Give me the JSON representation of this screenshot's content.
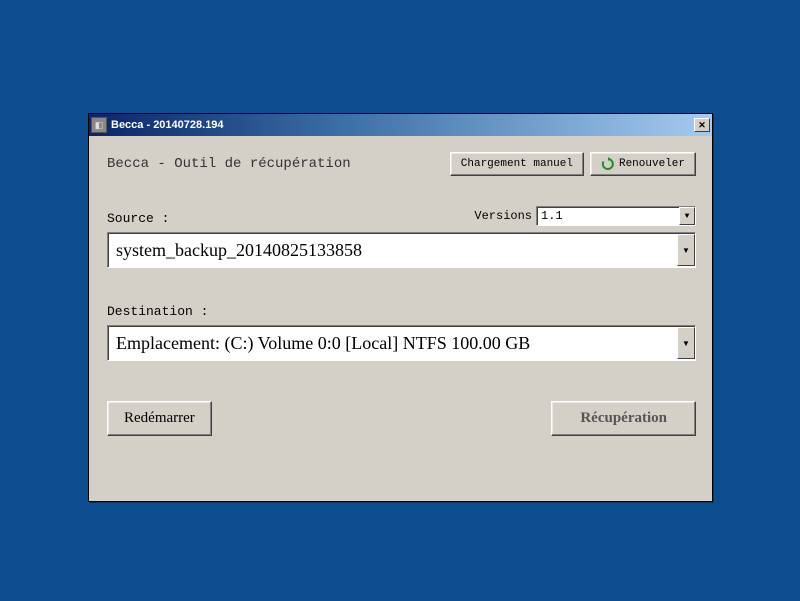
{
  "window": {
    "title": "Becca - 20140728.194"
  },
  "header": {
    "app_title": "Becca - Outil de récupération",
    "manual_load_label": "Chargement manuel",
    "refresh_label": "Renouveler"
  },
  "source": {
    "label": "Source :",
    "value": "system_backup_20140825133858"
  },
  "versions": {
    "label": "Versions",
    "value": "1.1"
  },
  "destination": {
    "label": "Destination :",
    "value": "Emplacement: (C:) Volume 0:0 [Local] NTFS 100.00 GB"
  },
  "footer": {
    "restart_label": "Redémarrer",
    "recover_label": "Récupération"
  }
}
